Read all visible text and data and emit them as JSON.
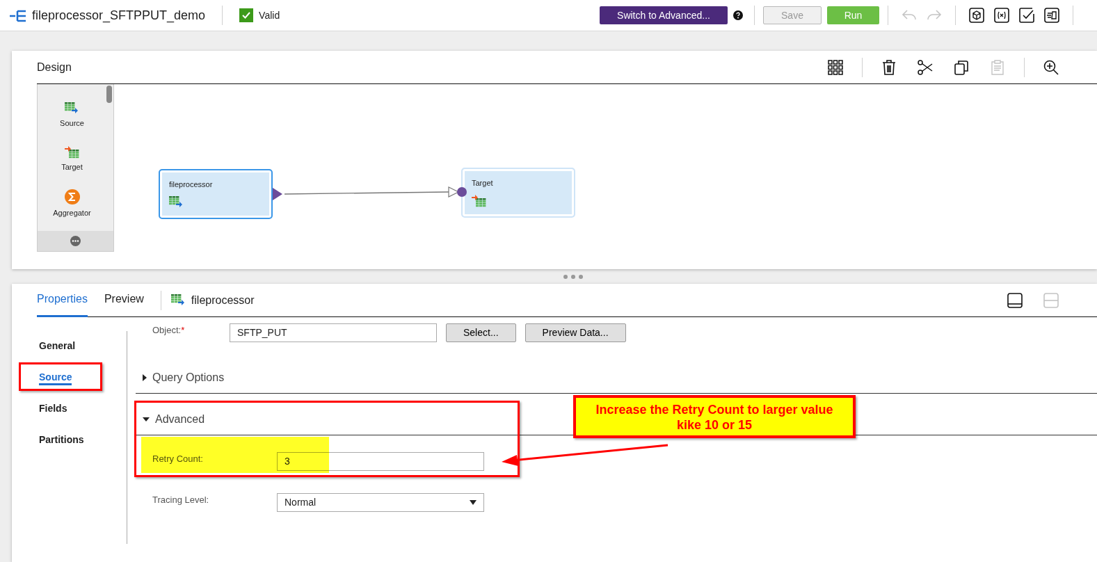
{
  "header": {
    "title": "fileprocessor_SFTPPUT_demo",
    "status": {
      "label": "Valid",
      "checked": true
    },
    "buttons": [
      {
        "label": "Switch to Advanced...",
        "kind": "advanced"
      },
      {
        "label": "Save",
        "kind": "save"
      },
      {
        "label": "Run",
        "kind": "run"
      }
    ],
    "tools": [
      {
        "kind": "undo",
        "disabled": true
      },
      {
        "kind": "redo",
        "disabled": true
      },
      {
        "kind": "cube",
        "disabled": false
      },
      {
        "kind": "expression",
        "disabled": false
      },
      {
        "kind": "validate",
        "disabled": false
      },
      {
        "kind": "document",
        "disabled": false
      }
    ]
  },
  "design": {
    "title": "Design",
    "tools": [
      {
        "kind": "grid",
        "disabled": false
      },
      {
        "kind": "delete",
        "disabled": false
      },
      {
        "kind": "cut",
        "disabled": false
      },
      {
        "kind": "copy",
        "disabled": false
      },
      {
        "kind": "paste",
        "disabled": true
      },
      {
        "kind": "zoom-in",
        "disabled": false
      }
    ],
    "palette": [
      {
        "label": "Source",
        "kind": "source"
      },
      {
        "label": "Target",
        "kind": "target"
      },
      {
        "label": "Aggregator",
        "kind": "aggregator"
      }
    ],
    "nodes": [
      {
        "label": "fileprocessor",
        "kind": "source",
        "selected": true
      },
      {
        "label": "Target",
        "kind": "target",
        "selected": false
      }
    ]
  },
  "properties": {
    "tabs": [
      {
        "label": "Properties",
        "selected": true
      },
      {
        "label": "Preview",
        "selected": false
      }
    ],
    "object_name": "fileprocessor",
    "layout_tools": [
      {
        "kind": "bottom",
        "disabled": false
      },
      {
        "kind": "split",
        "disabled": true
      }
    ],
    "nav": [
      {
        "label": "General",
        "selected": false
      },
      {
        "label": "Source",
        "selected": true
      },
      {
        "label": "Fields",
        "selected": false
      },
      {
        "label": "Partitions",
        "selected": false
      }
    ],
    "object": {
      "label": "Object:",
      "required_mark": "*",
      "value": "SFTP_PUT",
      "buttons": [
        "Select...",
        "Preview Data..."
      ]
    },
    "sections": [
      {
        "label": "Query Options",
        "expanded": false
      },
      {
        "label": "Advanced",
        "expanded": true,
        "fields": [
          {
            "label": "Retry Count:",
            "kind": "text",
            "value": "3"
          },
          {
            "label": "Tracing Level:",
            "kind": "select",
            "value": "Normal"
          }
        ]
      }
    ]
  },
  "annotation": {
    "callout": "Increase the Retry Count to larger value kike 10 or 15"
  }
}
